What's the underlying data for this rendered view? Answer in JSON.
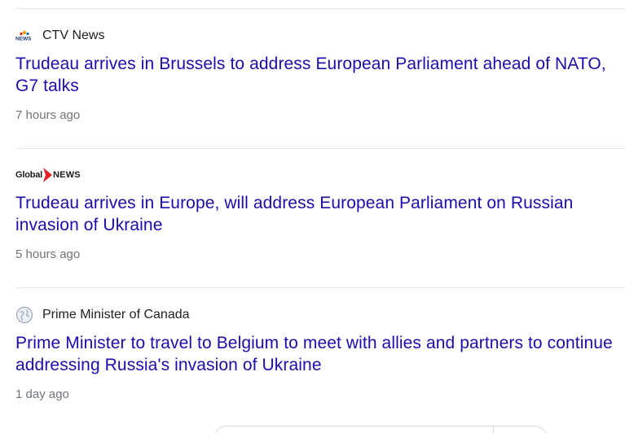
{
  "articles": [
    {
      "source": "CTV News",
      "source_logo": "ctv-news-logo",
      "headline": "Trudeau arrives in Brussels to address European Parliament ahead of NATO, G7 talks",
      "time": "7 hours ago"
    },
    {
      "source": "Global NEWS",
      "source_logo": "global-news-logo",
      "logo_text_left": "Global",
      "logo_text_right": "NEWS",
      "headline": "Trudeau arrives in Europe, will address European Parliament on Russian invasion of Ukraine",
      "time": "5 hours ago"
    },
    {
      "source": "Prime Minister of Canada",
      "source_logo": "globe-icon",
      "headline": "Prime Minister to travel to Belgium to meet with allies and partners to continue addressing Russia's invasion of Ukraine",
      "time": "1 day ago"
    }
  ],
  "colors": {
    "link": "#1a0dab",
    "text": "#202124",
    "muted": "#70757a",
    "divider": "#e6e6e6",
    "global_red": "#e31e24"
  }
}
